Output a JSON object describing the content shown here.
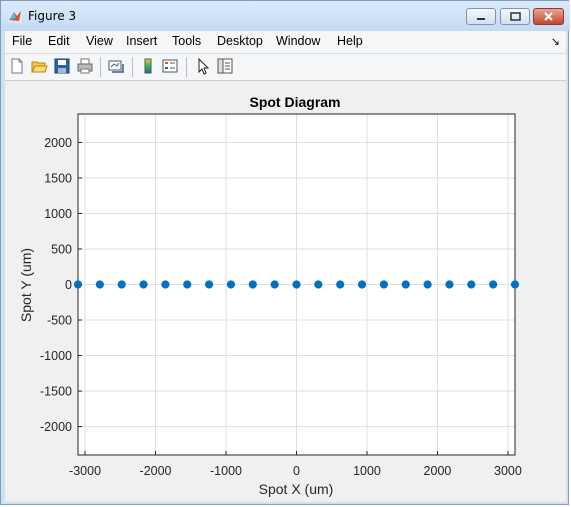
{
  "window": {
    "title": "Figure 3"
  },
  "menu": {
    "items": [
      "File",
      "Edit",
      "View",
      "Insert",
      "Tools",
      "Desktop",
      "Window",
      "Help"
    ],
    "overflow_icon": "dock-arrow-icon"
  },
  "toolbar": {
    "tools": [
      "new-figure-icon",
      "open-file-icon",
      "save-icon",
      "print-icon",
      "link-plot-icon",
      "insert-colorbar-icon",
      "insert-legend-icon",
      "edit-plot-icon",
      "property-inspector-icon"
    ]
  },
  "chart_data": {
    "type": "scatter",
    "title": "Spot Diagram",
    "xlabel": "Spot X (um)",
    "ylabel": "Spot Y (um)",
    "xlim": [
      -3100,
      3100
    ],
    "ylim": [
      -2400,
      2400
    ],
    "xticks": [
      -3000,
      -2000,
      -1000,
      0,
      1000,
      2000,
      3000
    ],
    "yticks": [
      -2000,
      -1500,
      -1000,
      -500,
      0,
      500,
      1000,
      1500,
      2000
    ],
    "grid": true,
    "marker_color": "#0072bd",
    "series": [
      {
        "x": [
          -3100,
          -2790,
          -2480,
          -2170,
          -1860,
          -1550,
          -1240,
          -930,
          -620,
          -310,
          0,
          310,
          620,
          930,
          1240,
          1550,
          1860,
          2170,
          2480,
          2790,
          3100
        ],
        "y": [
          0,
          0,
          0,
          0,
          0,
          0,
          0,
          0,
          0,
          0,
          0,
          0,
          0,
          0,
          0,
          0,
          0,
          0,
          0,
          0,
          0
        ]
      }
    ]
  }
}
